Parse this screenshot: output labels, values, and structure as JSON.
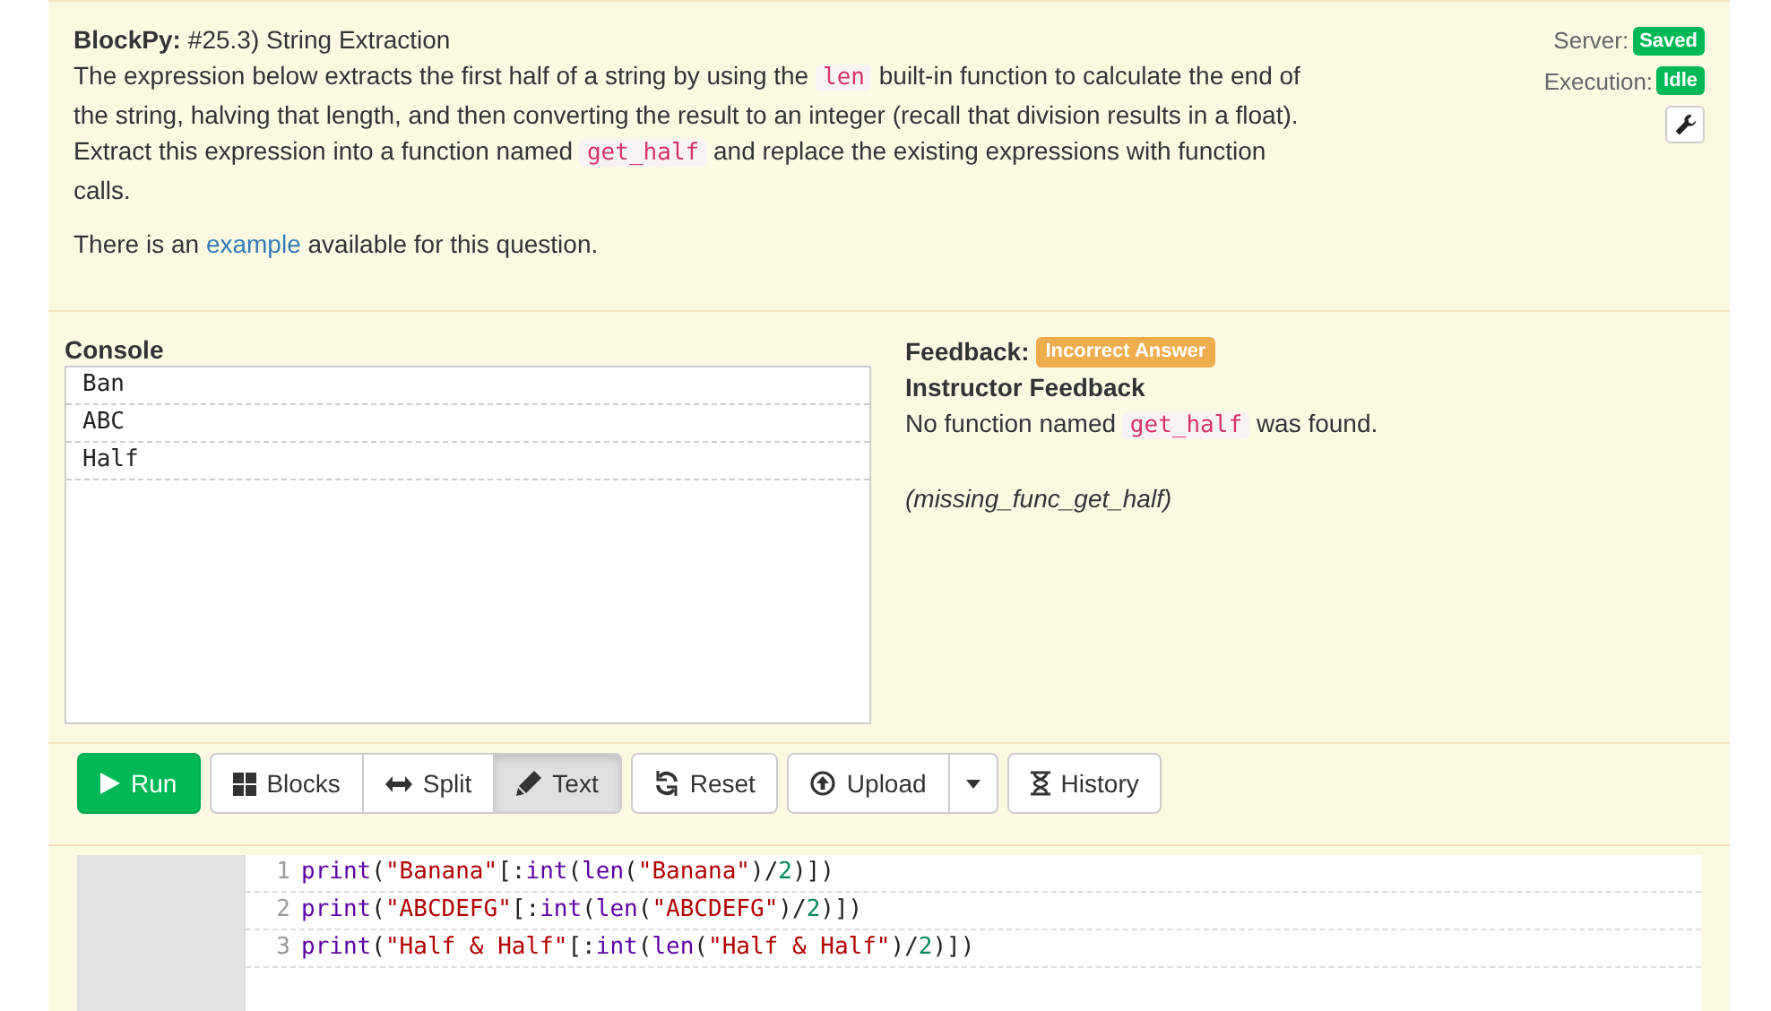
{
  "header": {
    "app": "BlockPy:",
    "title": "#25.3) String Extraction",
    "description": [
      {
        "kind": "text",
        "text": "The expression below extracts the first half of a string by using the"
      },
      {
        "kind": "code",
        "text": "len"
      },
      {
        "kind": "text",
        "text": "built-in function to calculate the end of the string, halving that length, and then converting the result to an integer (recall that division results in a float). Extract this expression into a function named"
      },
      {
        "kind": "code",
        "text": "get_half"
      },
      {
        "kind": "text",
        "text": "and replace the existing expressions with function calls."
      }
    ],
    "note": [
      {
        "kind": "text",
        "text": "There is an"
      },
      {
        "kind": "link",
        "text": "example"
      },
      {
        "kind": "text",
        "text": "available for this question."
      }
    ]
  },
  "status": [
    {
      "label": "Server:",
      "badge": "Saved"
    },
    {
      "label": "Execution:",
      "badge": "Idle"
    }
  ],
  "console": {
    "title": "Console",
    "lines": [
      "Ban",
      "ABC",
      "Half"
    ]
  },
  "feedback": {
    "label": "Feedback:",
    "badge": "Incorrect Answer",
    "title": "Instructor Feedback",
    "message": [
      {
        "kind": "text",
        "text": "No function named"
      },
      {
        "kind": "code",
        "text": "get_half"
      },
      {
        "kind": "text",
        "text": "was found."
      }
    ],
    "code": "(missing_func_get_half)"
  },
  "toolbar": [
    {
      "buttons": [
        {
          "kind": "run",
          "label": "Run"
        }
      ]
    },
    {
      "buttons": [
        {
          "kind": "blocks",
          "label": "Blocks",
          "selected": false
        },
        {
          "kind": "split",
          "label": "Split",
          "selected": false
        },
        {
          "kind": "text",
          "label": "Text",
          "selected": true
        }
      ]
    },
    {
      "buttons": [
        {
          "kind": "reset",
          "label": "Reset"
        }
      ]
    },
    {
      "buttons": [
        {
          "kind": "upload",
          "label": "Upload"
        },
        {
          "kind": "dropdown"
        }
      ]
    },
    {
      "buttons": [
        {
          "kind": "history",
          "label": "History"
        }
      ]
    }
  ],
  "editor": {
    "lines": [
      {
        "number": "1",
        "tokens": [
          {
            "kind": "builtin",
            "text": "print"
          },
          {
            "kind": "punct",
            "text": "("
          },
          {
            "kind": "string",
            "text": "\"Banana\""
          },
          {
            "kind": "punct",
            "text": "[:"
          },
          {
            "kind": "builtin",
            "text": "int"
          },
          {
            "kind": "punct",
            "text": "("
          },
          {
            "kind": "builtin",
            "text": "len"
          },
          {
            "kind": "punct",
            "text": "("
          },
          {
            "kind": "string",
            "text": "\"Banana\""
          },
          {
            "kind": "punct",
            "text": ")/"
          },
          {
            "kind": "number",
            "text": "2"
          },
          {
            "kind": "punct",
            "text": ")])"
          }
        ]
      },
      {
        "number": "2",
        "tokens": [
          {
            "kind": "builtin",
            "text": "print"
          },
          {
            "kind": "punct",
            "text": "("
          },
          {
            "kind": "string",
            "text": "\"ABCDEFG\""
          },
          {
            "kind": "punct",
            "text": "[:"
          },
          {
            "kind": "builtin",
            "text": "int"
          },
          {
            "kind": "punct",
            "text": "("
          },
          {
            "kind": "builtin",
            "text": "len"
          },
          {
            "kind": "punct",
            "text": "("
          },
          {
            "kind": "string",
            "text": "\"ABCDEFG\""
          },
          {
            "kind": "punct",
            "text": ")/"
          },
          {
            "kind": "number",
            "text": "2"
          },
          {
            "kind": "punct",
            "text": ")])"
          }
        ]
      },
      {
        "number": "3",
        "tokens": [
          {
            "kind": "builtin",
            "text": "print"
          },
          {
            "kind": "punct",
            "text": "("
          },
          {
            "kind": "string",
            "text": "\"Half & Half\""
          },
          {
            "kind": "punct",
            "text": "[:"
          },
          {
            "kind": "builtin",
            "text": "int"
          },
          {
            "kind": "punct",
            "text": "("
          },
          {
            "kind": "builtin",
            "text": "len"
          },
          {
            "kind": "punct",
            "text": "("
          },
          {
            "kind": "string",
            "text": "\"Half & Half\""
          },
          {
            "kind": "punct",
            "text": ")/"
          },
          {
            "kind": "number",
            "text": "2"
          },
          {
            "kind": "punct",
            "text": ")])"
          }
        ]
      }
    ]
  }
}
